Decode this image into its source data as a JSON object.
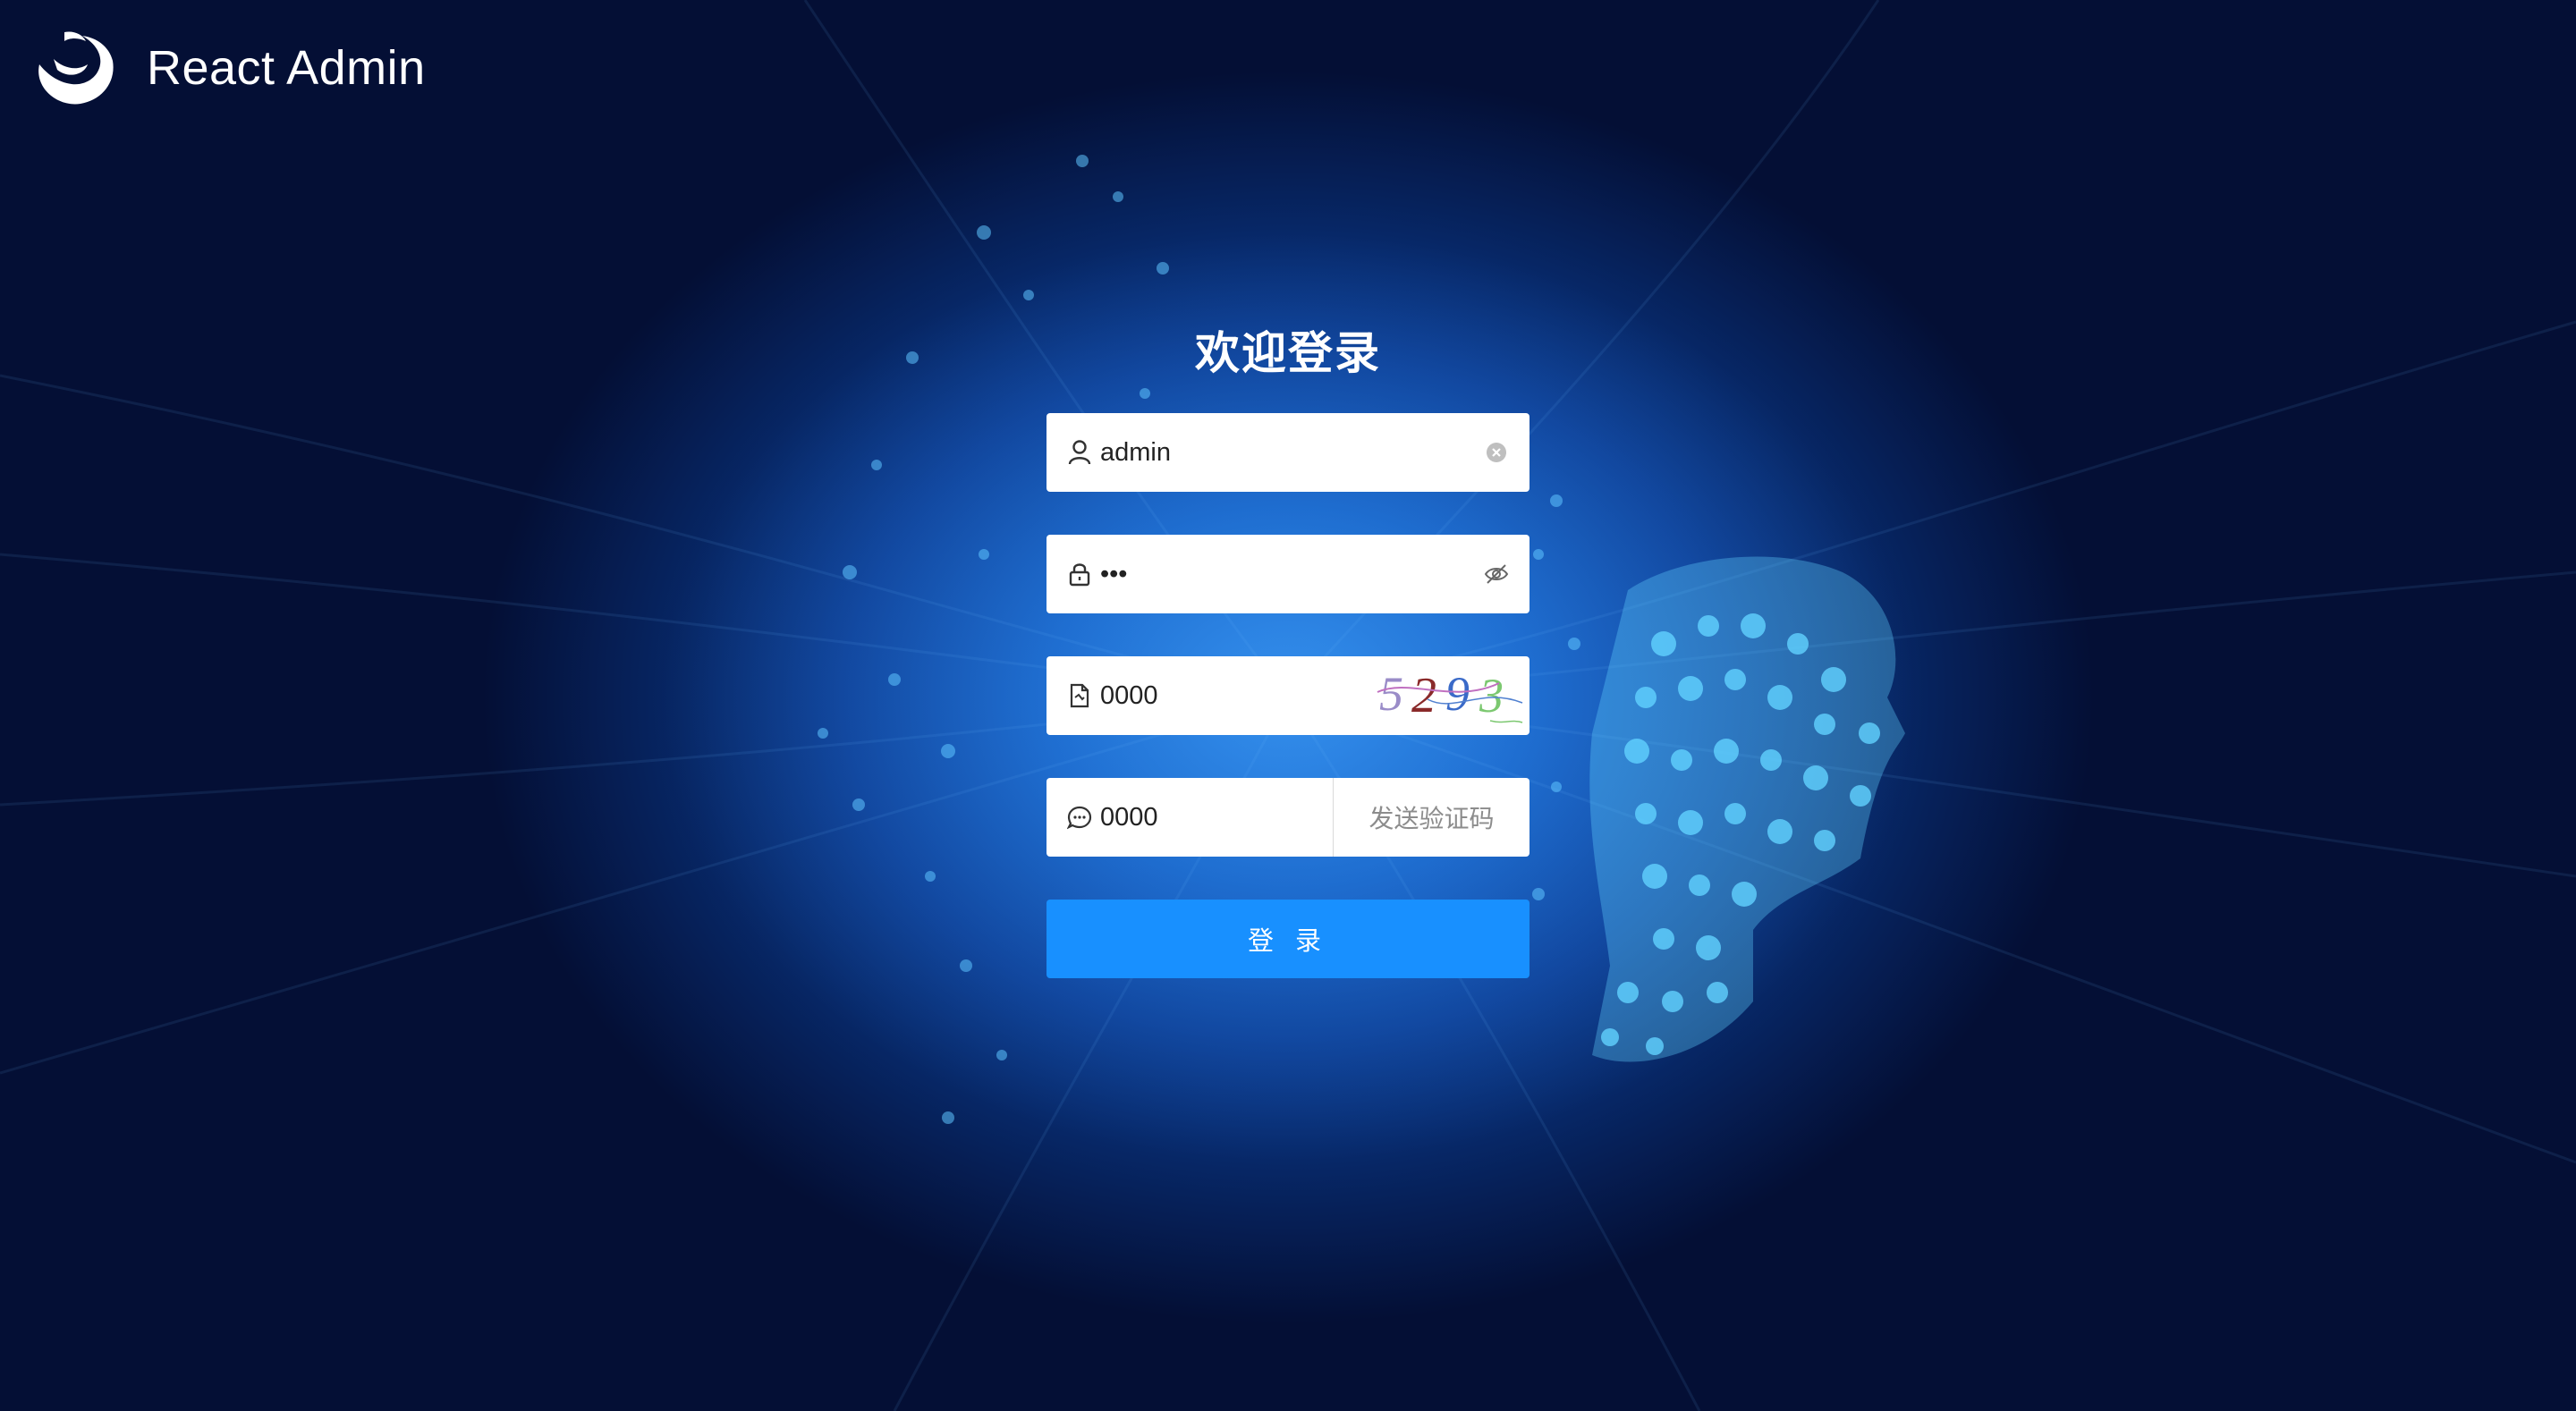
{
  "brand": {
    "name": "React Admin"
  },
  "login": {
    "title": "欢迎登录",
    "username": {
      "value": "admin",
      "icon": "user-icon",
      "clear_icon": "clear-icon"
    },
    "password": {
      "masked_value": "•••",
      "icon": "lock-icon",
      "toggle_icon": "eye-invisible-icon"
    },
    "captcha": {
      "value": "0000",
      "icon": "file-icon",
      "image_text": "5293"
    },
    "sms_code": {
      "value": "0000",
      "icon": "message-icon",
      "send_label": "发送验证码"
    },
    "submit_label": "登 录"
  },
  "colors": {
    "primary": "#1890ff",
    "background_dark": "#040f35",
    "background_light": "#1f7de3"
  }
}
